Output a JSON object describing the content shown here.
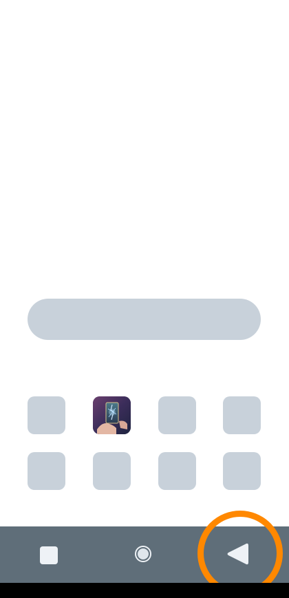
{
  "home": {
    "search_bar": {},
    "apps": [
      {
        "icon": "placeholder-app-icon"
      },
      {
        "icon": "magic-card-app-icon"
      },
      {
        "icon": "placeholder-app-icon"
      },
      {
        "icon": "placeholder-app-icon"
      },
      {
        "icon": "placeholder-app-icon"
      },
      {
        "icon": "placeholder-app-icon"
      },
      {
        "icon": "placeholder-app-icon"
      },
      {
        "icon": "placeholder-app-icon"
      }
    ]
  },
  "navigation_bar": {
    "buttons": [
      {
        "icon": "recents-square-icon"
      },
      {
        "icon": "home-circle-icon"
      },
      {
        "icon": "back-triangle-icon"
      }
    ]
  },
  "colors": {
    "screen_background": "#ffffff",
    "placeholder": "#c8d1da",
    "navbar": "#5f6e79",
    "nav_icons": "#eef2f6",
    "highlight": "#ff8800"
  }
}
